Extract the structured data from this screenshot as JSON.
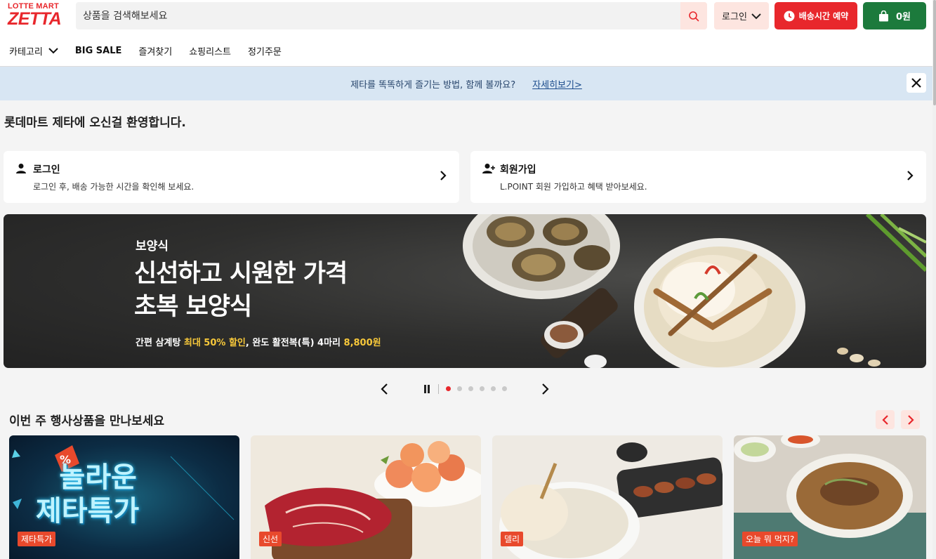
{
  "header": {
    "logo_top": "LOTTE MART",
    "logo_main": "ZETTA",
    "search_placeholder": "상품을 검색해보세요",
    "login_label": "로그인",
    "delivery_label": "배송시간 예약",
    "cart_label": "0원"
  },
  "nav": {
    "items": [
      {
        "label": "카테고리"
      },
      {
        "label": "BIG SALE"
      },
      {
        "label": "즐겨찾기"
      },
      {
        "label": "쇼핑리스트"
      },
      {
        "label": "정기주문"
      }
    ]
  },
  "notice": {
    "text": "제타를 똑똑하게 즐기는 방법, 함께 볼까요?",
    "link": "자세히보기>"
  },
  "welcome": "롯데마트 제타에 오신걸 환영합니다.",
  "cards": [
    {
      "title": "로그인",
      "desc": "로그인 후, 배송 가능한 시간을 확인해 보세요."
    },
    {
      "title": "회원가입",
      "desc": "L.POINT 회원 가입하고 혜택 받아보세요."
    }
  ],
  "banner": {
    "category": "보양식",
    "headline_1": "신선하고 시원한 가격",
    "headline_2": "초복 보양식",
    "sub_1": "간편 삼계탕 ",
    "sub_2": "최대 50% 할인",
    "sub_3": ", 완도 활전복(특) 4마리 ",
    "sub_4": "8,800원",
    "slide_count": 6,
    "active_slide": 1
  },
  "section": {
    "title": "이번 주 행사상품을 만나보세요"
  },
  "products": [
    {
      "tag": "제타특가",
      "promo_text_1": "놀라운",
      "promo_text_2": "제타특가"
    },
    {
      "tag": "신선"
    },
    {
      "tag": "델리"
    },
    {
      "tag": "오늘 뭐 먹지?"
    }
  ],
  "colors": {
    "brand_red": "#e8272c",
    "brand_green": "#1c7a3c",
    "notice_bg": "#d8e6f3",
    "soft_red": "#fde5e0"
  }
}
